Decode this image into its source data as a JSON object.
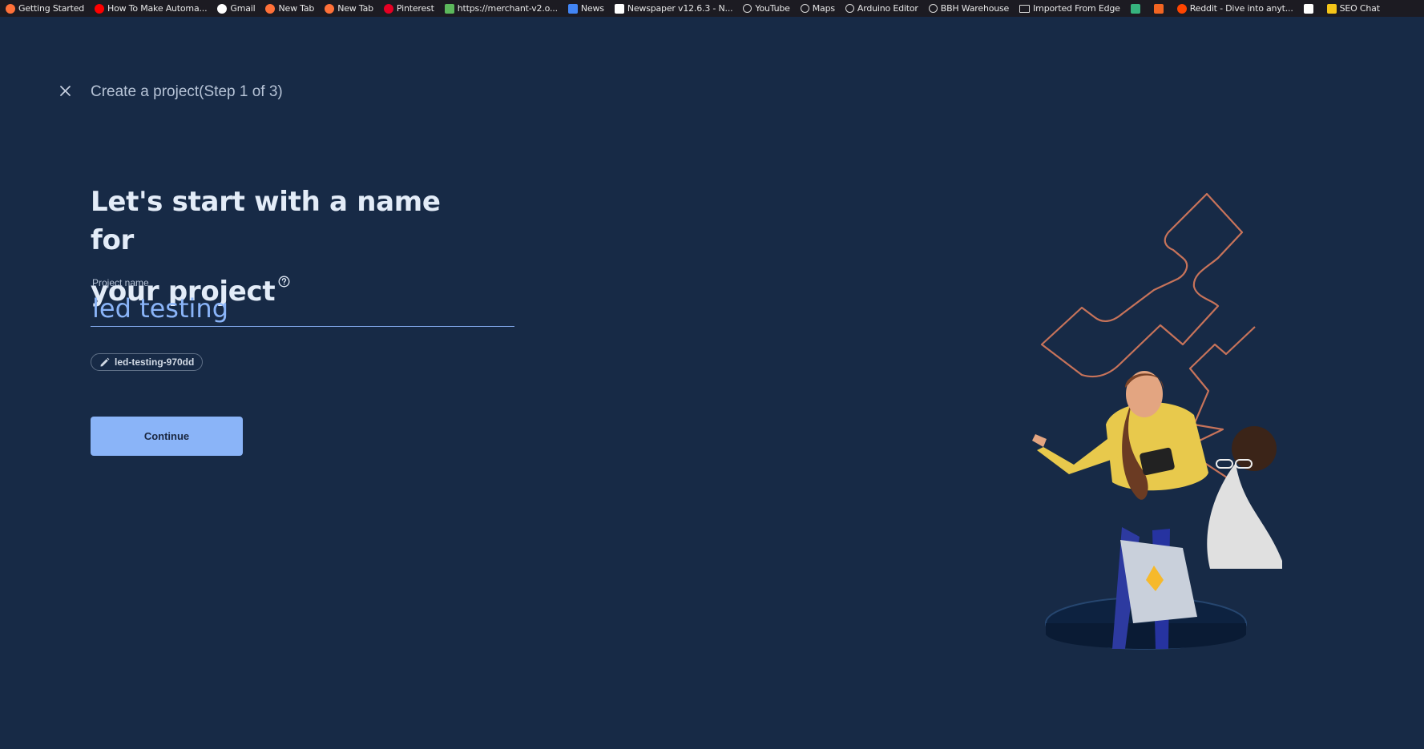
{
  "bookmarks": [
    {
      "label": "Getting Started",
      "icon": "firefox-icon",
      "color": "#ff7139"
    },
    {
      "label": "How To Make Automa...",
      "icon": "youtube-icon",
      "color": "#ff0000"
    },
    {
      "label": "Gmail",
      "icon": "google-icon",
      "color": "#ffffff"
    },
    {
      "label": "New Tab",
      "icon": "firefox-icon",
      "color": "#ff7139"
    },
    {
      "label": "New Tab",
      "icon": "firefox-icon",
      "color": "#ff7139"
    },
    {
      "label": "Pinterest",
      "icon": "pinterest-icon",
      "color": "#e60023"
    },
    {
      "label": "https://merchant-v2.o...",
      "icon": "shopify-icon",
      "color": "#5cb85c"
    },
    {
      "label": "News",
      "icon": "google-news-icon",
      "color": "#4285f4"
    },
    {
      "label": "Newspaper v12.6.3 - N...",
      "icon": "newspaper-icon",
      "color": "#ffffff"
    },
    {
      "label": "YouTube",
      "icon": "globe-icon",
      "color": "#d8d8d8"
    },
    {
      "label": "Maps",
      "icon": "globe-icon",
      "color": "#d8d8d8"
    },
    {
      "label": "Arduino Editor",
      "icon": "globe-icon",
      "color": "#d8d8d8"
    },
    {
      "label": "BBH Warehouse",
      "icon": "globe-icon",
      "color": "#d8d8d8"
    },
    {
      "label": "Imported From Edge",
      "icon": "folder-icon",
      "color": "#d8d8d8"
    },
    {
      "label": "",
      "icon": "px-icon",
      "color": "#36b37e"
    },
    {
      "label": "",
      "icon": "cp-icon",
      "color": "#f26522"
    },
    {
      "label": "Reddit - Dive into anyt...",
      "icon": "reddit-icon",
      "color": "#ff4500"
    },
    {
      "label": "",
      "icon": "medium-icon",
      "color": "#ffffff"
    },
    {
      "label": "SEO Chat",
      "icon": "seo-icon",
      "color": "#f5c518"
    }
  ],
  "header": {
    "step_title": "Create a project(Step 1 of 3)"
  },
  "main": {
    "heading_line1": "Let's start with a name for",
    "heading_line2": "your project",
    "project_name_label": "Project name",
    "project_name_value": "led testing",
    "project_id": "led-testing-970dd",
    "continue_label": "Continue"
  },
  "colors": {
    "background": "#172a46",
    "accent": "#8ab4f8",
    "heading": "#e3ecf8",
    "bookmarks_bar": "#1c1b22"
  }
}
